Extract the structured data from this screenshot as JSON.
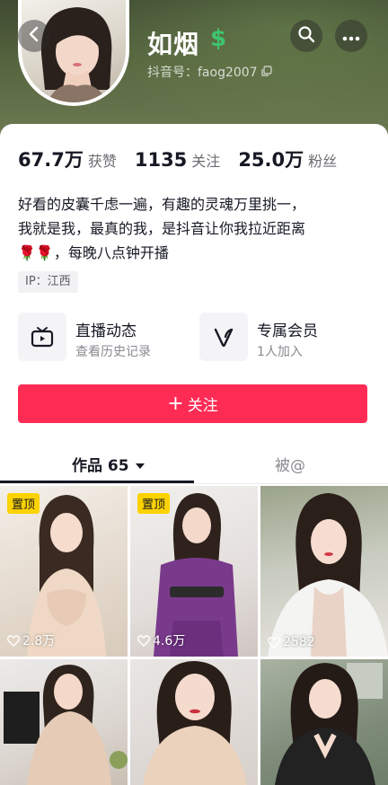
{
  "profile": {
    "name": "如烟",
    "douyin_id": "抖音号：faog2007"
  },
  "stats": [
    {
      "value": "67.7万",
      "label": "获赞"
    },
    {
      "value": "1135",
      "label": "关注"
    },
    {
      "value": "25.0万",
      "label": "粉丝"
    }
  ],
  "bio": {
    "line1": "好看的皮囊千虑一遍，有趣的灵魂万里挑一，",
    "line2": "我就是我，最真的我，是抖音让你我拉近距离",
    "roses": "🌹🌹",
    "line3": "，每晚八点钟开播"
  },
  "ip_tag": "IP：江西",
  "features": {
    "live": {
      "title": "直播动态",
      "subtitle": "查看历史记录"
    },
    "vip": {
      "title": "专属会员",
      "subtitle": "1人加入"
    }
  },
  "follow_button": {
    "label": "关注"
  },
  "tabs": [
    {
      "label": "作品 65",
      "active": true
    },
    {
      "label": "被@",
      "active": false
    }
  ],
  "videos": [
    {
      "pinned": true,
      "pin_label": "置顶",
      "likes": "2.8万"
    },
    {
      "pinned": true,
      "pin_label": "置顶",
      "likes": "4.6万"
    },
    {
      "pinned": false,
      "likes": "2582"
    },
    {
      "pinned": false,
      "likes": ""
    },
    {
      "pinned": false,
      "likes": ""
    },
    {
      "pinned": false,
      "likes": ""
    }
  ],
  "colors": {
    "accent": "#fe2c55",
    "pin": "#fcd200",
    "dollar_badge": "#3ec46d"
  }
}
